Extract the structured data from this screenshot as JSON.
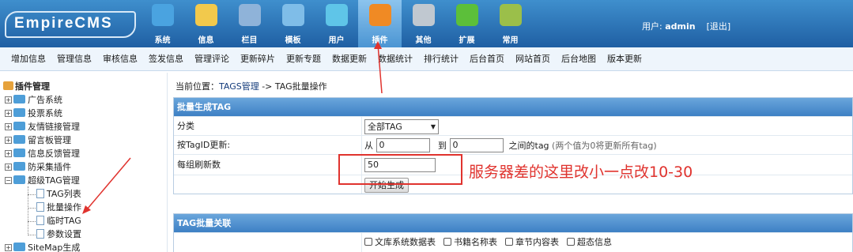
{
  "header": {
    "logo": "EmpireCMS",
    "nav": [
      {
        "label": "系统",
        "icon": "globe-icon",
        "color": "#4aa3e0"
      },
      {
        "label": "信息",
        "icon": "edit-document-icon",
        "color": "#f2c94c"
      },
      {
        "label": "栏目",
        "icon": "folder-icon",
        "color": "#8fb3d9"
      },
      {
        "label": "模板",
        "icon": "template-window-icon",
        "color": "#7fbde8"
      },
      {
        "label": "用户",
        "icon": "user-icon",
        "color": "#5fc5e8"
      },
      {
        "label": "插件",
        "icon": "tools-icon",
        "color": "#f08a24"
      },
      {
        "label": "其他",
        "icon": "gear-icon",
        "color": "#c0c8d0"
      },
      {
        "label": "扩展",
        "icon": "plus-circle-icon",
        "color": "#5cbf3a"
      },
      {
        "label": "常用",
        "icon": "bookmark-icon",
        "color": "#9bbf4a"
      }
    ],
    "active_nav": "插件",
    "user_label": "用户:",
    "username": "admin",
    "logout": "[退出]"
  },
  "submenu": [
    "增加信息",
    "管理信息",
    "审核信息",
    "签发信息",
    "管理评论",
    "更新碎片",
    "更新专题",
    "数据更新",
    "数据统计",
    "排行统计",
    "后台首页",
    "网站首页",
    "后台地图",
    "版本更新"
  ],
  "sidebar": {
    "title": "插件管理",
    "items": [
      "广告系统",
      "投票系统",
      "友情链接管理",
      "留言板管理",
      "信息反馈管理",
      "防采集插件",
      "超级TAG管理"
    ],
    "sub_items": [
      "TAG列表",
      "批量操作",
      "临时TAG",
      "参数设置"
    ],
    "last_item": "SiteMap生成"
  },
  "breadcrumb": {
    "prefix": "当前位置：",
    "link": "TAGS管理",
    "suffix": " -> TAG批量操作"
  },
  "panel1": {
    "title": "批量生成TAG",
    "category_label": "分类",
    "category_value": "全部TAG",
    "update_label": "按TagID更新:",
    "from_label": "从",
    "from_value": "0",
    "to_label": "到",
    "to_value": "0",
    "range_suffix": "之间的tag",
    "range_hint": "(两个值为0将更新所有tag)",
    "per_group_label": "每组刷新数",
    "per_group_value": "50",
    "start_button": "开始生成"
  },
  "panel2": {
    "title": "TAG批量关联",
    "checkboxes": [
      "文库系统数据表",
      "书籍名称表",
      "章节内容表",
      "超态信息"
    ]
  },
  "annotation": {
    "note": "服务器差的这里改小一点改10-30",
    "color": "#e0332e"
  }
}
